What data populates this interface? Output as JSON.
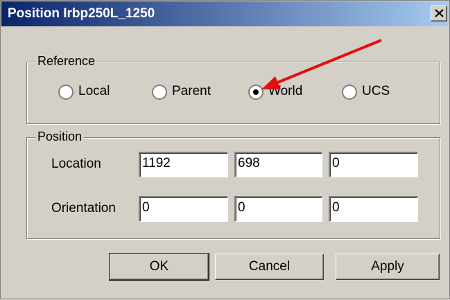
{
  "window": {
    "title": "Position Irbp250L_1250"
  },
  "reference": {
    "label": "Reference",
    "options": [
      "Local",
      "Parent",
      "World",
      "UCS"
    ],
    "selected": "World"
  },
  "position": {
    "label": "Position",
    "location_label": "Location",
    "location": [
      "1192",
      "698",
      "0"
    ],
    "orientation_label": "Orientation",
    "orientation": [
      "0",
      "0",
      "0"
    ]
  },
  "buttons": {
    "ok": "OK",
    "cancel": "Cancel",
    "apply": "Apply"
  },
  "annotation": {
    "arrow_color": "#e01010"
  }
}
